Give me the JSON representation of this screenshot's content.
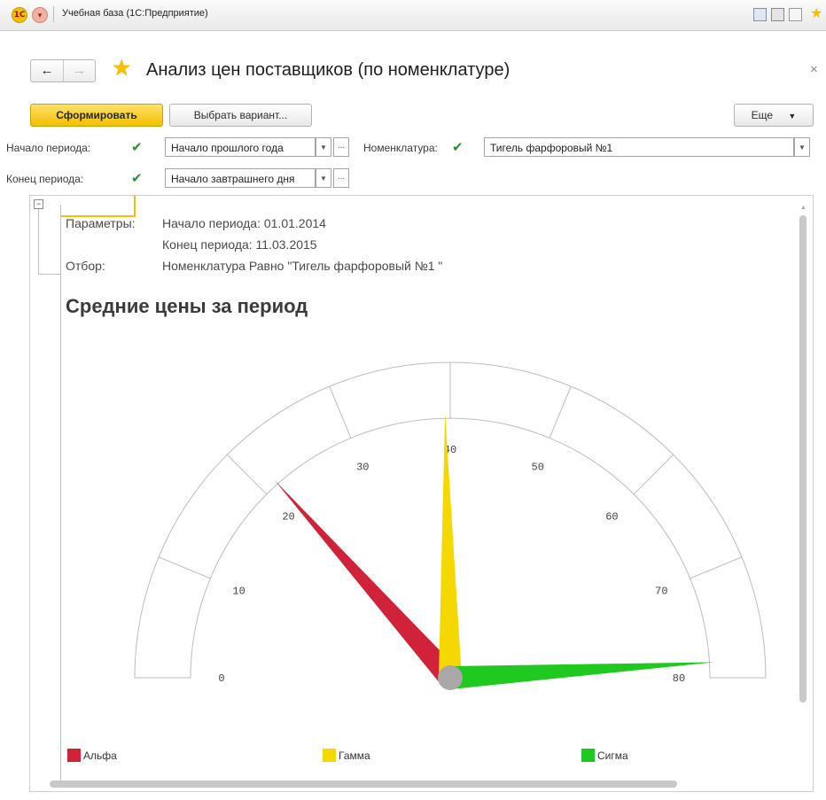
{
  "window": {
    "title": "Учебная база  (1С:Предприятие)"
  },
  "form": {
    "title": "Анализ цен поставщиков (по номенклатуре)"
  },
  "toolbar": {
    "generate_label": "Сформировать",
    "variant_label": "Выбрать вариант...",
    "more_label": "Еще"
  },
  "filters": {
    "period_start_label": "Начало периода:",
    "period_start_value": "Начало прошлого года",
    "period_end_label": "Конец периода:",
    "period_end_value": "Начало завтрашнего дня",
    "nomenclature_label": "Номенклатура:",
    "nomenclature_value": "Тигель фарфоровый №1",
    "ellipsis": "..."
  },
  "report": {
    "params_label": "Параметры:",
    "param_start": "Начало периода: 01.01.2014",
    "param_end": "Конец периода: 11.03.2015",
    "filter_label": "Отбор:",
    "filter_value": "Номенклатура Равно \"Тигель фарфоровый №1 \"",
    "title": "Средние цены за период"
  },
  "chart_data": {
    "type": "gauge",
    "title": "Средние цены за период",
    "scale_min": 0,
    "scale_max": 80,
    "ticks": [
      0,
      10,
      20,
      30,
      40,
      50,
      60,
      70,
      80
    ],
    "series": [
      {
        "name": "Альфа",
        "value": 21.5,
        "color": "#d0233a"
      },
      {
        "name": "Гамма",
        "value": 39.5,
        "color": "#f5d800"
      },
      {
        "name": "Сигма",
        "value": 78.5,
        "color": "#1fc91f"
      }
    ],
    "legend_position": "bottom"
  },
  "colors": {
    "accent": "#f2c200",
    "checkbox": "#2e8f2e"
  }
}
